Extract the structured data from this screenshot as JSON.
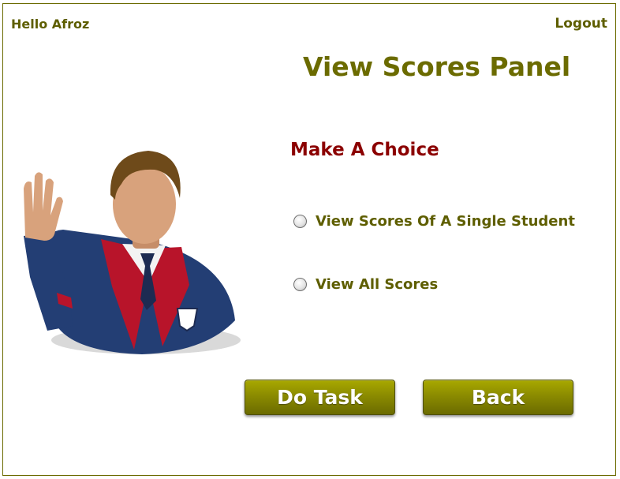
{
  "header": {
    "greeting": "Hello Afroz",
    "logout_label": "Logout"
  },
  "panel": {
    "title": "View Scores Panel",
    "subtitle": "Make A Choice",
    "options": [
      {
        "label": "View Scores Of A Single Student",
        "selected": false
      },
      {
        "label": "View All Scores",
        "selected": false
      }
    ]
  },
  "buttons": {
    "do_task_label": "Do Task",
    "back_label": "Back"
  },
  "illustration": {
    "icon": "student-waving-avatar",
    "colors": {
      "jacket": "#233e74",
      "vest": "#b8142a",
      "hair": "#6e4a1a",
      "skin": "#d8a27c"
    }
  },
  "colors": {
    "accent": "#6b6b00",
    "heading_red": "#8b0000",
    "button_fill": "#8b8b00",
    "button_text": "#ffffff"
  }
}
